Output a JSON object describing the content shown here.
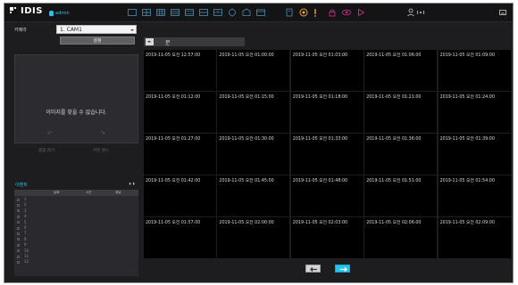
{
  "app": {
    "logo_text": "IDIS",
    "user_name": "admin"
  },
  "toolbar": {
    "icons": [
      "single-view-icon",
      "quad-view-icon",
      "split-3x3-icon",
      "split-4x4-icon",
      "split-5x5-icon",
      "layout-icon",
      "layout-2-icon",
      "target-icon",
      "fullscreen-icon",
      "folder-icon",
      "clipboard-icon",
      "search-playback-icon",
      "alarm-icon",
      "lock-icon",
      "eye-icon",
      "play-icon"
    ],
    "right_icons": [
      "user-icon",
      "signal-icon",
      "minimize-icon"
    ]
  },
  "left_panel": {
    "camera_label": "카메라",
    "camera_value": "1. CAM1",
    "settings_button": "설정",
    "preview_message": "이미지를 찾을 수 없습니다.",
    "rotate_left": "↶",
    "rotate_right": "↷",
    "ghost_button_1": "줌업 하기",
    "ghost_button_2": "이전 센스"
  },
  "event_panel": {
    "title": "이벤트",
    "nav": "⏵ ⏵",
    "columns": [
      "날짜",
      "시간",
      "채널"
    ],
    "rows": [
      "1",
      "2",
      "3",
      "4",
      "5",
      "6",
      "7",
      "8",
      "9",
      "10",
      "11",
      "12"
    ]
  },
  "date_bar": {
    "separator": "·",
    "value": "분"
  },
  "thumbnails": [
    "2019-11-05  오전 12:57:00",
    "2019-11-05  오전 01:00:00",
    "2019-11-05  오전 01:03:00",
    "2019-11-05  오전 01:06:00",
    "2019-11-05  오전 01:09:00",
    "2019-11-05  오전 01:12:00",
    "2019-11-05  오전 01:15:00",
    "2019-11-05  오전 01:18:00",
    "2019-11-05  오전 01:21:00",
    "2019-11-05  오전 01:24:00",
    "2019-11-05  오전 01:27:00",
    "2019-11-05  오전 01:30:00",
    "2019-11-05  오전 01:33:00",
    "2019-11-05  오전 01:36:00",
    "2019-11-05  오전 01:39:00",
    "2019-11-05  오전 01:42:00",
    "2019-11-05  오전 01:45:00",
    "2019-11-05  오전 01:48:00",
    "2019-11-05  오전 01:51:00",
    "2019-11-05  오전 01:54:00",
    "2019-11-05  오전 01:57:00",
    "2019-11-05  오전 02:00:00",
    "2019-11-05  오전 02:03:00",
    "2019-11-05  오전 02:06:00",
    "2019-11-05  오전 02:09:00"
  ],
  "pager": {
    "prev_icon": "arrow-left-icon",
    "next_icon": "arrow-right-icon"
  },
  "colors": {
    "accent": "#23c4f0",
    "background": "#1d1d1f"
  }
}
